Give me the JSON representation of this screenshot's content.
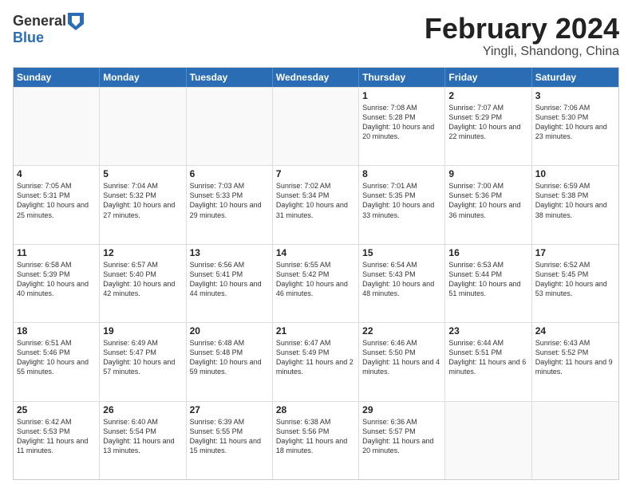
{
  "logo": {
    "general": "General",
    "blue": "Blue"
  },
  "title": "February 2024",
  "location": "Yingli, Shandong, China",
  "days": [
    "Sunday",
    "Monday",
    "Tuesday",
    "Wednesday",
    "Thursday",
    "Friday",
    "Saturday"
  ],
  "weeks": [
    [
      {
        "day": "",
        "empty": true
      },
      {
        "day": "",
        "empty": true
      },
      {
        "day": "",
        "empty": true
      },
      {
        "day": "",
        "empty": true
      },
      {
        "day": "1",
        "sunrise": "Sunrise: 7:08 AM",
        "sunset": "Sunset: 5:28 PM",
        "daylight": "Daylight: 10 hours and 20 minutes."
      },
      {
        "day": "2",
        "sunrise": "Sunrise: 7:07 AM",
        "sunset": "Sunset: 5:29 PM",
        "daylight": "Daylight: 10 hours and 22 minutes."
      },
      {
        "day": "3",
        "sunrise": "Sunrise: 7:06 AM",
        "sunset": "Sunset: 5:30 PM",
        "daylight": "Daylight: 10 hours and 23 minutes."
      }
    ],
    [
      {
        "day": "4",
        "sunrise": "Sunrise: 7:05 AM",
        "sunset": "Sunset: 5:31 PM",
        "daylight": "Daylight: 10 hours and 25 minutes."
      },
      {
        "day": "5",
        "sunrise": "Sunrise: 7:04 AM",
        "sunset": "Sunset: 5:32 PM",
        "daylight": "Daylight: 10 hours and 27 minutes."
      },
      {
        "day": "6",
        "sunrise": "Sunrise: 7:03 AM",
        "sunset": "Sunset: 5:33 PM",
        "daylight": "Daylight: 10 hours and 29 minutes."
      },
      {
        "day": "7",
        "sunrise": "Sunrise: 7:02 AM",
        "sunset": "Sunset: 5:34 PM",
        "daylight": "Daylight: 10 hours and 31 minutes."
      },
      {
        "day": "8",
        "sunrise": "Sunrise: 7:01 AM",
        "sunset": "Sunset: 5:35 PM",
        "daylight": "Daylight: 10 hours and 33 minutes."
      },
      {
        "day": "9",
        "sunrise": "Sunrise: 7:00 AM",
        "sunset": "Sunset: 5:36 PM",
        "daylight": "Daylight: 10 hours and 36 minutes."
      },
      {
        "day": "10",
        "sunrise": "Sunrise: 6:59 AM",
        "sunset": "Sunset: 5:38 PM",
        "daylight": "Daylight: 10 hours and 38 minutes."
      }
    ],
    [
      {
        "day": "11",
        "sunrise": "Sunrise: 6:58 AM",
        "sunset": "Sunset: 5:39 PM",
        "daylight": "Daylight: 10 hours and 40 minutes."
      },
      {
        "day": "12",
        "sunrise": "Sunrise: 6:57 AM",
        "sunset": "Sunset: 5:40 PM",
        "daylight": "Daylight: 10 hours and 42 minutes."
      },
      {
        "day": "13",
        "sunrise": "Sunrise: 6:56 AM",
        "sunset": "Sunset: 5:41 PM",
        "daylight": "Daylight: 10 hours and 44 minutes."
      },
      {
        "day": "14",
        "sunrise": "Sunrise: 6:55 AM",
        "sunset": "Sunset: 5:42 PM",
        "daylight": "Daylight: 10 hours and 46 minutes."
      },
      {
        "day": "15",
        "sunrise": "Sunrise: 6:54 AM",
        "sunset": "Sunset: 5:43 PM",
        "daylight": "Daylight: 10 hours and 48 minutes."
      },
      {
        "day": "16",
        "sunrise": "Sunrise: 6:53 AM",
        "sunset": "Sunset: 5:44 PM",
        "daylight": "Daylight: 10 hours and 51 minutes."
      },
      {
        "day": "17",
        "sunrise": "Sunrise: 6:52 AM",
        "sunset": "Sunset: 5:45 PM",
        "daylight": "Daylight: 10 hours and 53 minutes."
      }
    ],
    [
      {
        "day": "18",
        "sunrise": "Sunrise: 6:51 AM",
        "sunset": "Sunset: 5:46 PM",
        "daylight": "Daylight: 10 hours and 55 minutes."
      },
      {
        "day": "19",
        "sunrise": "Sunrise: 6:49 AM",
        "sunset": "Sunset: 5:47 PM",
        "daylight": "Daylight: 10 hours and 57 minutes."
      },
      {
        "day": "20",
        "sunrise": "Sunrise: 6:48 AM",
        "sunset": "Sunset: 5:48 PM",
        "daylight": "Daylight: 10 hours and 59 minutes."
      },
      {
        "day": "21",
        "sunrise": "Sunrise: 6:47 AM",
        "sunset": "Sunset: 5:49 PM",
        "daylight": "Daylight: 11 hours and 2 minutes."
      },
      {
        "day": "22",
        "sunrise": "Sunrise: 6:46 AM",
        "sunset": "Sunset: 5:50 PM",
        "daylight": "Daylight: 11 hours and 4 minutes."
      },
      {
        "day": "23",
        "sunrise": "Sunrise: 6:44 AM",
        "sunset": "Sunset: 5:51 PM",
        "daylight": "Daylight: 11 hours and 6 minutes."
      },
      {
        "day": "24",
        "sunrise": "Sunrise: 6:43 AM",
        "sunset": "Sunset: 5:52 PM",
        "daylight": "Daylight: 11 hours and 9 minutes."
      }
    ],
    [
      {
        "day": "25",
        "sunrise": "Sunrise: 6:42 AM",
        "sunset": "Sunset: 5:53 PM",
        "daylight": "Daylight: 11 hours and 11 minutes."
      },
      {
        "day": "26",
        "sunrise": "Sunrise: 6:40 AM",
        "sunset": "Sunset: 5:54 PM",
        "daylight": "Daylight: 11 hours and 13 minutes."
      },
      {
        "day": "27",
        "sunrise": "Sunrise: 6:39 AM",
        "sunset": "Sunset: 5:55 PM",
        "daylight": "Daylight: 11 hours and 15 minutes."
      },
      {
        "day": "28",
        "sunrise": "Sunrise: 6:38 AM",
        "sunset": "Sunset: 5:56 PM",
        "daylight": "Daylight: 11 hours and 18 minutes."
      },
      {
        "day": "29",
        "sunrise": "Sunrise: 6:36 AM",
        "sunset": "Sunset: 5:57 PM",
        "daylight": "Daylight: 11 hours and 20 minutes."
      },
      {
        "day": "",
        "empty": true
      },
      {
        "day": "",
        "empty": true
      }
    ]
  ]
}
